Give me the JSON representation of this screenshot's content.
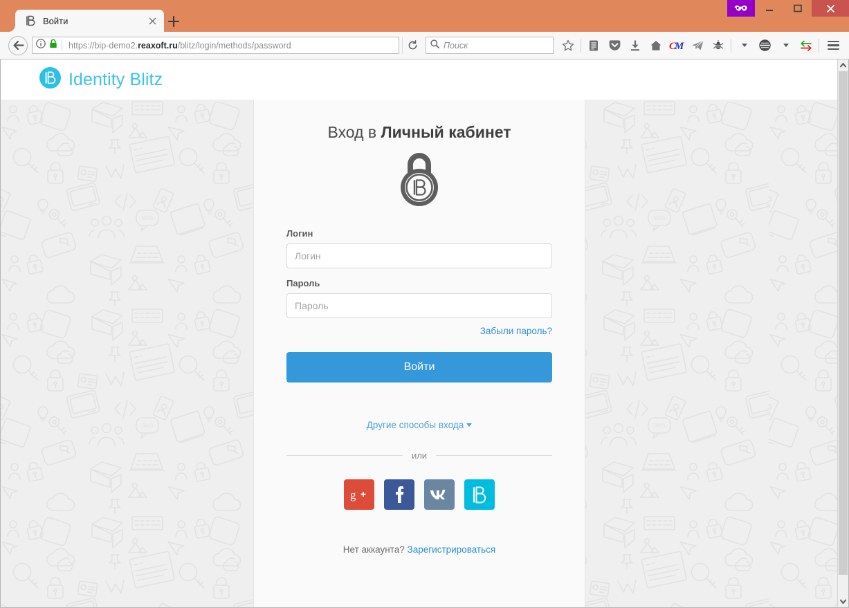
{
  "browser": {
    "tab": {
      "title": "Войти",
      "favicon_icon": "identity-blitz-icon",
      "close_icon": "close-icon"
    },
    "new_tab_label": "+",
    "window_controls": {
      "privacy_icon": "private-browsing-mask-icon",
      "minimize_label": "—",
      "maximize_label": "▢",
      "close_label": "✕"
    },
    "nav": {
      "back_icon": "back-arrow-icon",
      "info_icon": "site-info-icon",
      "lock_icon": "secure-lock-icon",
      "url_prefix": "https://bip-demo2.",
      "url_domain": "reaxoft.ru",
      "url_suffix": "/blitz/login/methods/password",
      "reload_icon": "reload-icon",
      "search_placeholder": "Поиск",
      "search_icon": "search-icon",
      "toolbar_icons": [
        "bookmark-star-icon",
        "reader-list-icon",
        "pocket-icon",
        "downloads-icon",
        "home-icon",
        "cm-addon-icon",
        "telegram-icon",
        "bug-addon-icon",
        "addon-dropdown-caret",
        "account-icon",
        "account-dropdown-caret",
        "sync-arrows-icon",
        "hamburger-menu-icon"
      ]
    }
  },
  "site": {
    "brand_name": "Identity Blitz",
    "brand_icon": "identity-blitz-logo-icon",
    "login_card": {
      "title_regular": "Вход в ",
      "title_bold": "Личный кабинет",
      "lock_icon": "identity-blitz-padlock-icon",
      "login_label": "Логин",
      "login_placeholder": "Логин",
      "login_value": "",
      "password_label": "Пароль",
      "password_placeholder": "Пароль",
      "password_value": "",
      "forgot_password_link": "Забыли пароль?",
      "submit_label": "Войти",
      "other_methods_link": "Другие способы входа",
      "divider_label": "или",
      "socials": [
        {
          "name": "google-plus",
          "glyph": "g+",
          "color": "#dd4b39"
        },
        {
          "name": "facebook",
          "glyph": "f",
          "color": "#3b5998"
        },
        {
          "name": "vkontakte",
          "glyph": "vk",
          "color": "#6b86a3"
        },
        {
          "name": "identity-blitz",
          "glyph": "B",
          "color": "#00bcdf"
        }
      ],
      "signup_prompt": "Нет аккаунта?",
      "signup_link": "Зарегистрироваться"
    }
  },
  "colors": {
    "chrome_accent": "#e0875c",
    "brand": "#3cc3e8",
    "primary_button": "#3498db",
    "link": "#2f8fd4",
    "card_bg": "#fafafa",
    "page_bg": "#efefef"
  },
  "scrollbar": {
    "up_icon": "scroll-up-arrow-icon",
    "down_icon": "scroll-down-arrow-icon"
  }
}
